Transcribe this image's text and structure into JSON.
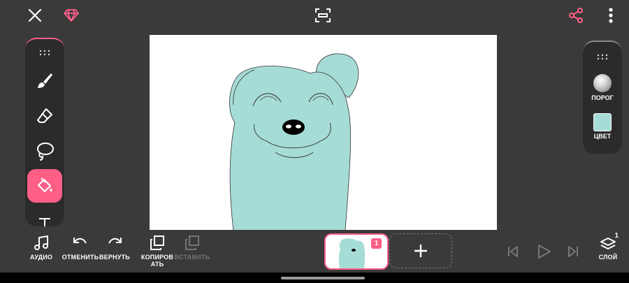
{
  "toolbar_top": {
    "close_icon": "close-icon",
    "premium_icon": "diamond-icon",
    "fullscreen_icon": "fullscreen-icon",
    "share_icon": "share-icon",
    "more_icon": "more-vertical-icon"
  },
  "left_tools": [
    "brush-icon",
    "eraser-icon",
    "lasso-icon",
    "fill-bucket-icon",
    "text-icon"
  ],
  "right_panel": {
    "threshold_label": "ПОРОГ",
    "color_label": "ЦВЕТ",
    "selected_color": "#a6dcd6"
  },
  "bottom": {
    "audio_label": "АУДИО",
    "undo_label": "ОТМЕНИТЬ",
    "redo_label": "ВЕРНУТЬ",
    "copy_label": "КОПИРОВАТЬ",
    "paste_label": "ВСТАВИТЬ",
    "layer_label": "СЛОЙ",
    "layer_count": "1",
    "frame_number": "1"
  },
  "colors": {
    "accent": "#ff5f87",
    "background": "#3a3a3a",
    "panel": "#2b2b2b",
    "character": "#a6dcd6"
  }
}
